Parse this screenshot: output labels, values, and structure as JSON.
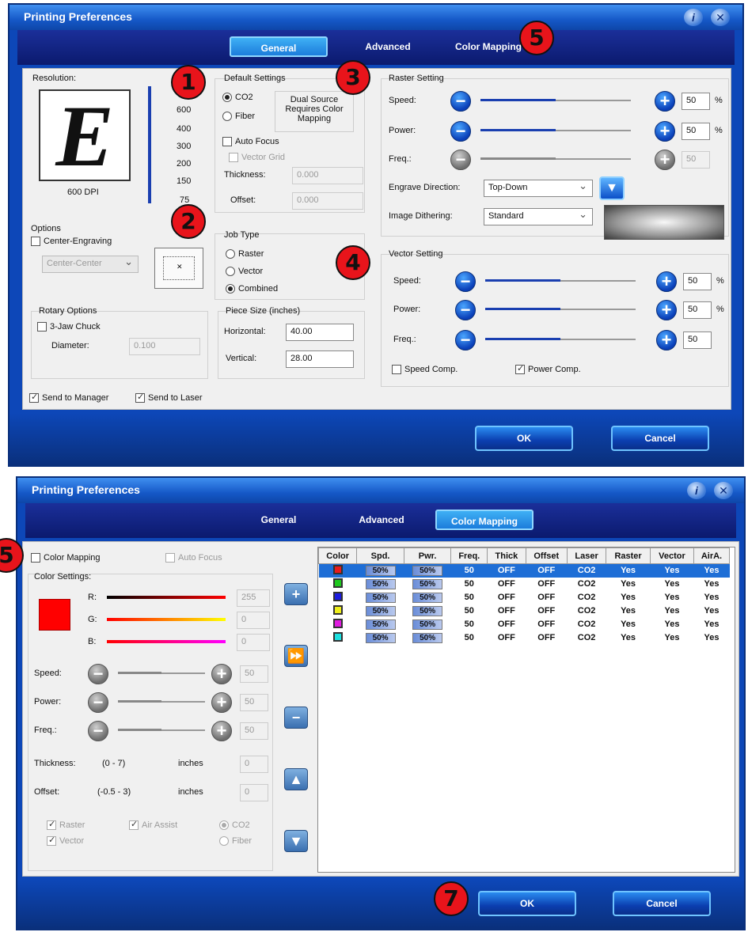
{
  "top": {
    "title": "Printing Preferences",
    "tabs": [
      "General",
      "Advanced",
      "Color Mapping"
    ],
    "resolution": {
      "label": "Resolution:",
      "preview_letter": "E",
      "dpi_label": "600 DPI",
      "scale": [
        "600",
        "400",
        "300",
        "200",
        "150",
        "75"
      ]
    },
    "default_settings": {
      "label": "Default Settings",
      "co2": "CO2",
      "fiber": "Fiber",
      "dual_note": "Dual Source Requires Color Mapping",
      "auto_focus": "Auto Focus",
      "vector_grid": "Vector Grid",
      "thickness_label": "Thickness:",
      "thickness_value": "0.000",
      "offset_label": "Offset:",
      "offset_value": "0.000"
    },
    "options": {
      "label": "Options",
      "center_engraving": "Center-Engraving",
      "center_select": "Center-Center"
    },
    "job_type": {
      "label": "Job Type",
      "raster": "Raster",
      "vector": "Vector",
      "combined": "Combined"
    },
    "rotary": {
      "label": "Rotary Options",
      "chuck": "3-Jaw Chuck",
      "diameter_label": "Diameter:",
      "diameter_value": "0.100"
    },
    "piece_size": {
      "label": "Piece Size (inches)",
      "horizontal_label": "Horizontal:",
      "horizontal_value": "40.00",
      "vertical_label": "Vertical:",
      "vertical_value": "28.00"
    },
    "raster": {
      "label": "Raster Setting",
      "speed_label": "Speed:",
      "speed_value": "50",
      "speed_unit": "%",
      "speed_level": 0.5,
      "power_label": "Power:",
      "power_value": "50",
      "power_unit": "%",
      "power_level": 0.5,
      "freq_label": "Freq.:",
      "freq_value": "50",
      "freq_level": 0.5,
      "direction_label": "Engrave Direction:",
      "direction_value": "Top-Down",
      "dithering_label": "Image Dithering:",
      "dithering_value": "Standard"
    },
    "vector": {
      "label": "Vector Setting",
      "speed_label": "Speed:",
      "speed_value": "50",
      "speed_unit": "%",
      "power_label": "Power:",
      "power_value": "50",
      "power_unit": "%",
      "freq_label": "Freq.:",
      "freq_value": "50",
      "speed_comp": "Speed Comp.",
      "power_comp": "Power Comp."
    },
    "send_manager": "Send to Manager",
    "send_laser": "Send to Laser",
    "ok": "OK",
    "cancel": "Cancel"
  },
  "bottom": {
    "title": "Printing Preferences",
    "tabs": [
      "General",
      "Advanced",
      "Color Mapping"
    ],
    "color_mapping": "Color Mapping",
    "auto_focus": "Auto Focus",
    "color_settings": "Color Settings:",
    "r_label": "R:",
    "r_value": "255",
    "g_label": "G:",
    "g_value": "0",
    "b_label": "B:",
    "b_value": "0",
    "speed_label": "Speed:",
    "speed_value": "50",
    "power_label": "Power:",
    "power_value": "50",
    "freq_label": "Freq.:",
    "freq_value": "50",
    "thickness_label": "Thickness:",
    "thickness_range": "(0  -  7)",
    "thickness_unit": "inches",
    "thickness_value": "0",
    "offset_label": "Offset:",
    "offset_range": "(-0.5  -  3)",
    "offset_unit": "inches",
    "offset_value": "0",
    "raster": "Raster",
    "vector": "Vector",
    "air_assist": "Air Assist",
    "co2": "CO2",
    "fiber": "Fiber",
    "table_headers": [
      "Color",
      "Spd.",
      "Pwr.",
      "Freq.",
      "Thick",
      "Offset",
      "Laser",
      "Raster",
      "Vector",
      "AirA."
    ],
    "rows": [
      {
        "color": "#e81c1c",
        "spd": "50%",
        "pwr": "50%",
        "freq": "50",
        "thick": "OFF",
        "offset": "OFF",
        "laser": "CO2",
        "raster": "Yes",
        "vector": "Yes",
        "air": "Yes"
      },
      {
        "color": "#1ec81e",
        "spd": "50%",
        "pwr": "50%",
        "freq": "50",
        "thick": "OFF",
        "offset": "OFF",
        "laser": "CO2",
        "raster": "Yes",
        "vector": "Yes",
        "air": "Yes"
      },
      {
        "color": "#1c1ce0",
        "spd": "50%",
        "pwr": "50%",
        "freq": "50",
        "thick": "OFF",
        "offset": "OFF",
        "laser": "CO2",
        "raster": "Yes",
        "vector": "Yes",
        "air": "Yes"
      },
      {
        "color": "#f0f01c",
        "spd": "50%",
        "pwr": "50%",
        "freq": "50",
        "thick": "OFF",
        "offset": "OFF",
        "laser": "CO2",
        "raster": "Yes",
        "vector": "Yes",
        "air": "Yes"
      },
      {
        "color": "#e01ce0",
        "spd": "50%",
        "pwr": "50%",
        "freq": "50",
        "thick": "OFF",
        "offset": "OFF",
        "laser": "CO2",
        "raster": "Yes",
        "vector": "Yes",
        "air": "Yes"
      },
      {
        "color": "#1ce0e0",
        "spd": "50%",
        "pwr": "50%",
        "freq": "50",
        "thick": "OFF",
        "offset": "OFF",
        "laser": "CO2",
        "raster": "Yes",
        "vector": "Yes",
        "air": "Yes"
      }
    ],
    "ok": "OK",
    "cancel": "Cancel"
  },
  "markers": [
    "1",
    "2",
    "3",
    "4",
    "5",
    "5",
    "7"
  ]
}
